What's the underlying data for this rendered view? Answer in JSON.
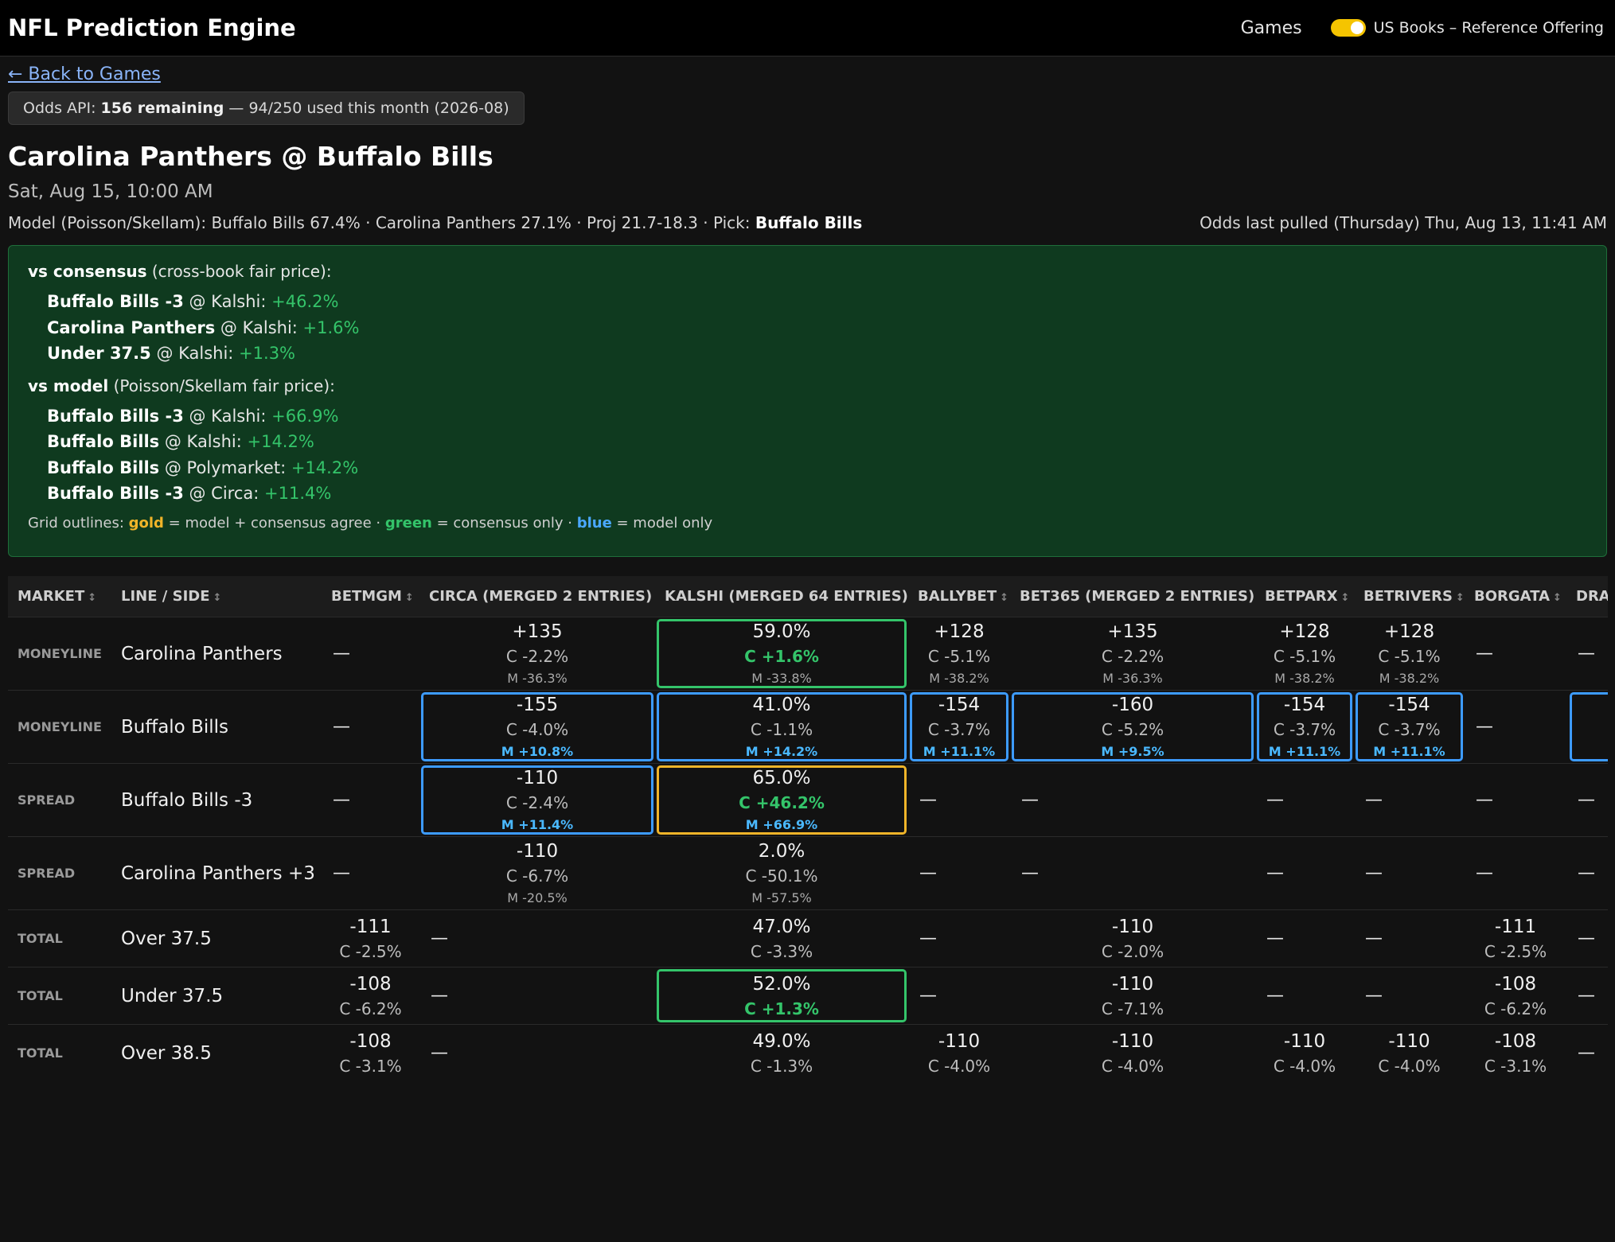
{
  "app": {
    "title": "NFL Prediction Engine",
    "nav_games": "Games",
    "toggle_label": "US Books – Reference Offering"
  },
  "back_link": "← Back to Games",
  "quota": {
    "prefix": "Odds API: ",
    "remaining": "156 remaining",
    "suffix": " — 94/250 used this month (2026-08)"
  },
  "game": {
    "title": "Carolina Panthers @ Buffalo Bills",
    "time": "Sat, Aug 15, 10:00 AM",
    "model_text": "Model (Poisson/Skellam): Buffalo Bills 67.4% · Carolina Panthers 27.1% · Proj 21.7-18.3 · Pick: ",
    "pick": "Buffalo Bills",
    "odds_pulled": "Odds last pulled (Thursday) Thu, Aug 13, 11:41 AM"
  },
  "edges": {
    "consensus_title": "vs consensus",
    "consensus_sub": " (cross-book fair price):",
    "consensus": [
      {
        "label": "Buffalo Bills -3",
        "book": " @ Kalshi: ",
        "edge": "+46.2%"
      },
      {
        "label": "Carolina Panthers",
        "book": " @ Kalshi: ",
        "edge": "+1.6%"
      },
      {
        "label": "Under 37.5",
        "book": " @ Kalshi: ",
        "edge": "+1.3%"
      }
    ],
    "model_title": "vs model",
    "model_sub": " (Poisson/Skellam fair price):",
    "model": [
      {
        "label": "Buffalo Bills -3",
        "book": " @ Kalshi: ",
        "edge": "+66.9%"
      },
      {
        "label": "Buffalo Bills",
        "book": " @ Kalshi: ",
        "edge": "+14.2%"
      },
      {
        "label": "Buffalo Bills",
        "book": " @ Polymarket: ",
        "edge": "+14.2%"
      },
      {
        "label": "Buffalo Bills -3",
        "book": " @ Circa: ",
        "edge": "+11.4%"
      }
    ],
    "legend": {
      "prefix": "Grid outlines: ",
      "gold": "gold",
      "gold_desc": " = model + consensus agree · ",
      "green": "green",
      "green_desc": " = consensus only · ",
      "blue": "blue",
      "blue_desc": " = model only"
    }
  },
  "table": {
    "columns": [
      "MARKET",
      "LINE / SIDE",
      "BETMGM",
      "CIRCA (MERGED 2 ENTRIES)",
      "KALSHI (MERGED 64 ENTRIES)",
      "BALLYBET",
      "BET365 (MERGED 2 ENTRIES)",
      "BETPARX",
      "BETRIVERS",
      "BORGATA",
      "DRAFTKINGS"
    ],
    "sort_icon": "↕",
    "dash": "—",
    "rows": [
      {
        "market": "MONEYLINE",
        "side": "Carolina Panthers",
        "cells": [
          null,
          {
            "price": "+135",
            "c": "C -2.2%",
            "m": "M -36.3%"
          },
          {
            "price": "59.0%",
            "c": "C +1.6%",
            "m": "M -33.8%",
            "c_pos": true,
            "outline": "green"
          },
          {
            "price": "+128",
            "c": "C -5.1%",
            "m": "M -38.2%"
          },
          {
            "price": "+135",
            "c": "C -2.2%",
            "m": "M -36.3%"
          },
          {
            "price": "+128",
            "c": "C -5.1%",
            "m": "M -38.2%"
          },
          {
            "price": "+128",
            "c": "C -5.1%",
            "m": "M -38.2%"
          },
          null,
          null
        ]
      },
      {
        "market": "MONEYLINE",
        "side": "Buffalo Bills",
        "cells": [
          null,
          {
            "price": "-155",
            "c": "C -4.0%",
            "m": "M +10.8%",
            "m_pos": true,
            "outline": "blue"
          },
          {
            "price": "41.0%",
            "c": "C -1.1%",
            "m": "M +14.2%",
            "m_pos": true,
            "outline": "blue"
          },
          {
            "price": "-154",
            "c": "C -3.7%",
            "m": "M +11.1%",
            "m_pos": true,
            "outline": "blue"
          },
          {
            "price": "-160",
            "c": "C -5.2%",
            "m": "M +9.5%",
            "m_pos": true,
            "outline": "blue"
          },
          {
            "price": "-154",
            "c": "C -3.7%",
            "m": "M +11.1%",
            "m_pos": true,
            "outline": "blue"
          },
          {
            "price": "-154",
            "c": "C -3.7%",
            "m": "M +11.1%",
            "m_pos": true,
            "outline": "blue"
          },
          null,
          {
            "cut": true
          }
        ]
      },
      {
        "market": "SPREAD",
        "side": "Buffalo Bills -3",
        "cells": [
          null,
          {
            "price": "-110",
            "c": "C -2.4%",
            "m": "M +11.4%",
            "m_pos": true,
            "outline": "blue"
          },
          {
            "price": "65.0%",
            "c": "C +46.2%",
            "m": "M +66.9%",
            "c_pos": true,
            "m_pos": true,
            "outline": "gold"
          },
          null,
          null,
          null,
          null,
          null,
          null
        ]
      },
      {
        "market": "SPREAD",
        "side": "Carolina Panthers +3",
        "cells": [
          null,
          {
            "price": "-110",
            "c": "C -6.7%",
            "m": "M -20.5%"
          },
          {
            "price": "2.0%",
            "c": "C -50.1%",
            "m": "M -57.5%"
          },
          null,
          null,
          null,
          null,
          null,
          null
        ]
      },
      {
        "market": "TOTAL",
        "side": "Over 37.5",
        "cells": [
          {
            "price": "-111",
            "c": "C -2.5%"
          },
          null,
          {
            "price": "47.0%",
            "c": "C -3.3%"
          },
          null,
          {
            "price": "-110",
            "c": "C -2.0%"
          },
          null,
          null,
          {
            "price": "-111",
            "c": "C -2.5%"
          },
          null
        ]
      },
      {
        "market": "TOTAL",
        "side": "Under 37.5",
        "cells": [
          {
            "price": "-108",
            "c": "C -6.2%"
          },
          null,
          {
            "price": "52.0%",
            "c": "C +1.3%",
            "c_pos": true,
            "outline": "green"
          },
          null,
          {
            "price": "-110",
            "c": "C -7.1%"
          },
          null,
          null,
          {
            "price": "-108",
            "c": "C -6.2%"
          },
          null
        ]
      },
      {
        "market": "TOTAL",
        "side": "Over 38.5",
        "cells": [
          {
            "price": "-108",
            "c": "C -3.1%"
          },
          null,
          {
            "price": "49.0%",
            "c": "C -1.3%"
          },
          {
            "price": "-110",
            "c": "C -4.0%"
          },
          {
            "price": "-110",
            "c": "C -4.0%"
          },
          {
            "price": "-110",
            "c": "C -4.0%"
          },
          {
            "price": "-110",
            "c": "C -4.0%"
          },
          {
            "price": "-108",
            "c": "C -3.1%"
          },
          null
        ]
      }
    ]
  }
}
